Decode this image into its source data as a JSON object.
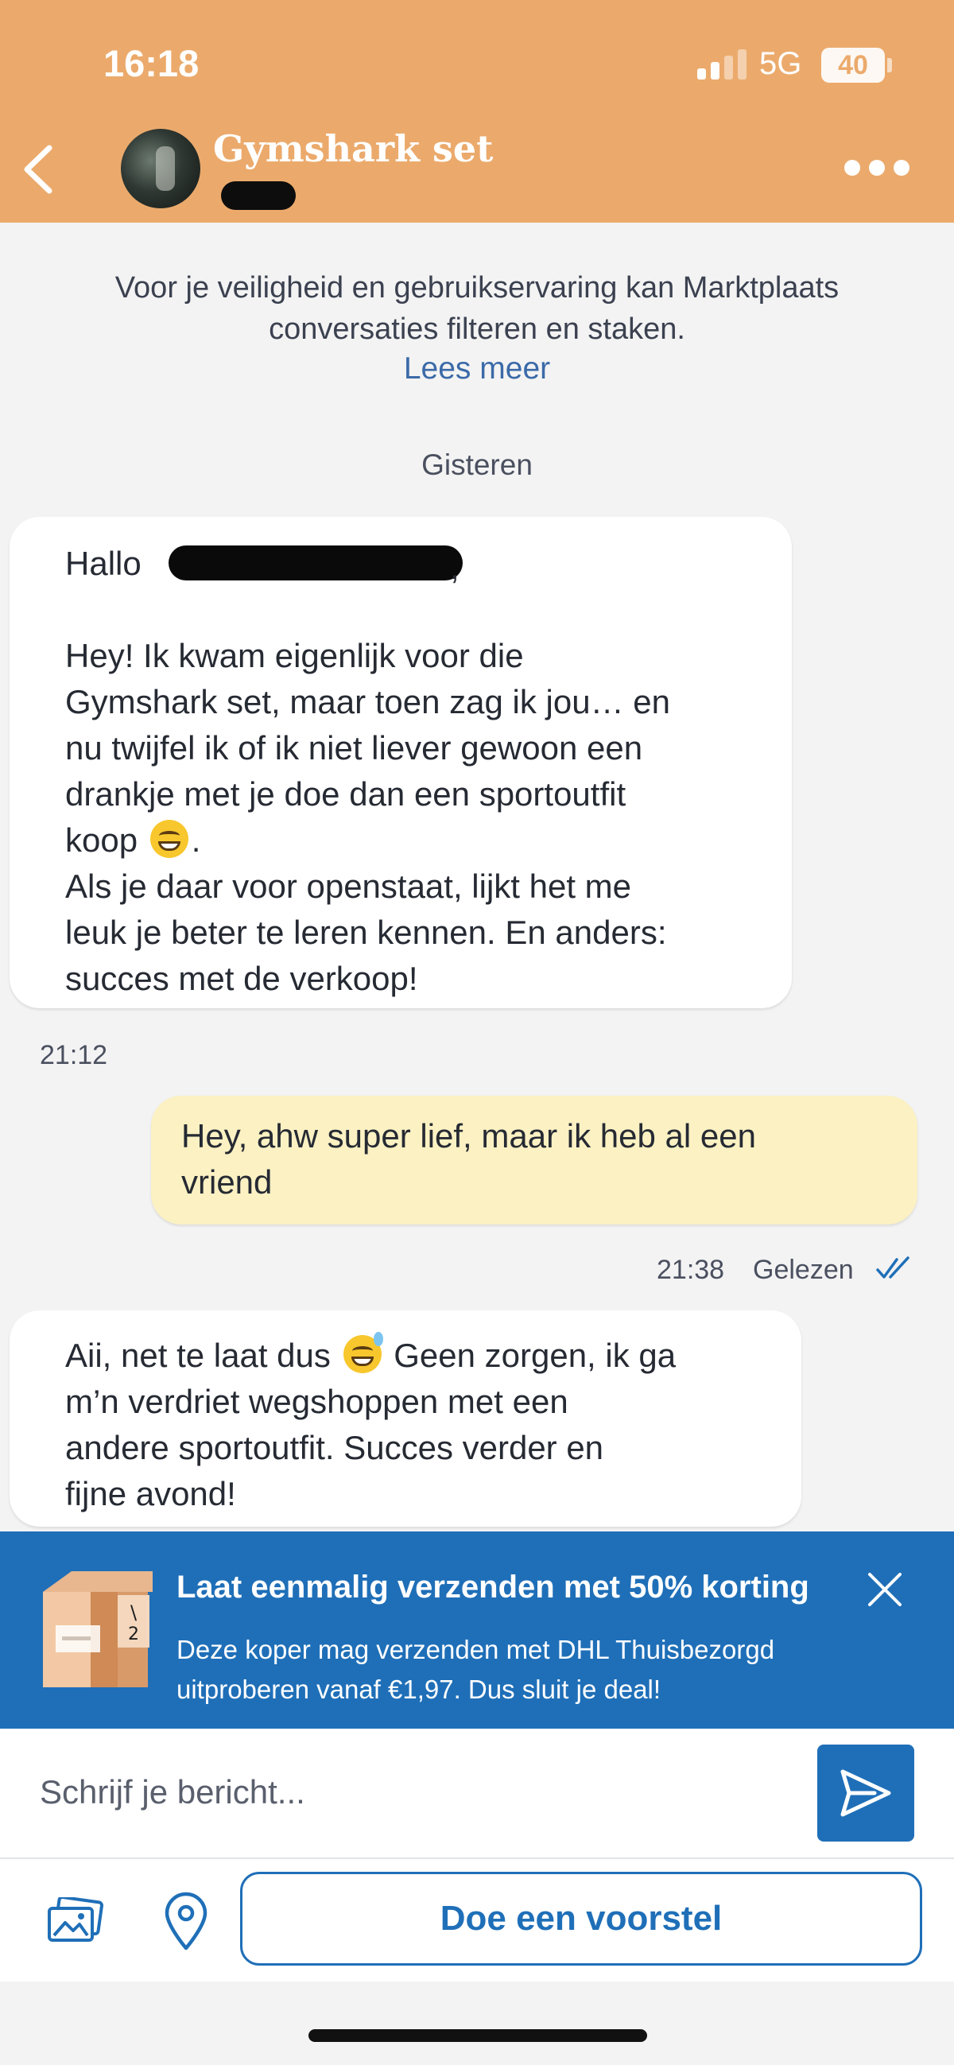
{
  "status_bar": {
    "time": "16:18",
    "network": "5G",
    "battery": "40"
  },
  "header": {
    "title": "Gymshark set"
  },
  "notice": {
    "line1": "Voor je veiligheid en gebruikservaring kan Marktplaats",
    "line2": "conversaties filteren en staken.",
    "link": "Lees meer"
  },
  "day_label": "Gisteren",
  "messages": [
    {
      "direction": "incoming",
      "greeting": "Hallo",
      "lines": [
        "Hey! Ik kwam eigenlijk voor die",
        "Gymshark set, maar toen zag ik jou… en",
        "nu twijfel ik of ik niet liever gewoon een",
        "drankje met je doe dan een sportoutfit",
        "koop",
        ".",
        "Als je daar voor openstaat, lijkt het me",
        "leuk je beter te leren kennen. En anders:",
        "succes met de verkoop!"
      ],
      "time": "21:12"
    },
    {
      "direction": "outgoing",
      "lines": [
        "Hey, ahw super lief, maar ik heb al een",
        "vriend"
      ],
      "time": "21:38",
      "status": "Gelezen"
    },
    {
      "direction": "incoming",
      "lines": [
        "Aii, net te laat dus",
        "Geen zorgen, ik ga",
        "m’n verdriet wegshoppen met een",
        "andere sportoutfit. Succes verder en",
        "fijne avond!"
      ]
    }
  ],
  "promo": {
    "title": "Laat eenmalig verzenden met 50% korting",
    "line1": "Deze koper mag verzenden met DHL Thuisbezorgd",
    "line2": "uitproberen vanaf €1,97. Dus sluit je deal!"
  },
  "composer": {
    "placeholder": "Schrijf je bericht..."
  },
  "actions": {
    "offer_label": "Doe een voorstel"
  },
  "colors": {
    "header": "#ebaa6c",
    "brand_blue": "#1f6fb8",
    "outgoing_bubble": "#fbf1c3",
    "background": "#f3f3f3"
  }
}
